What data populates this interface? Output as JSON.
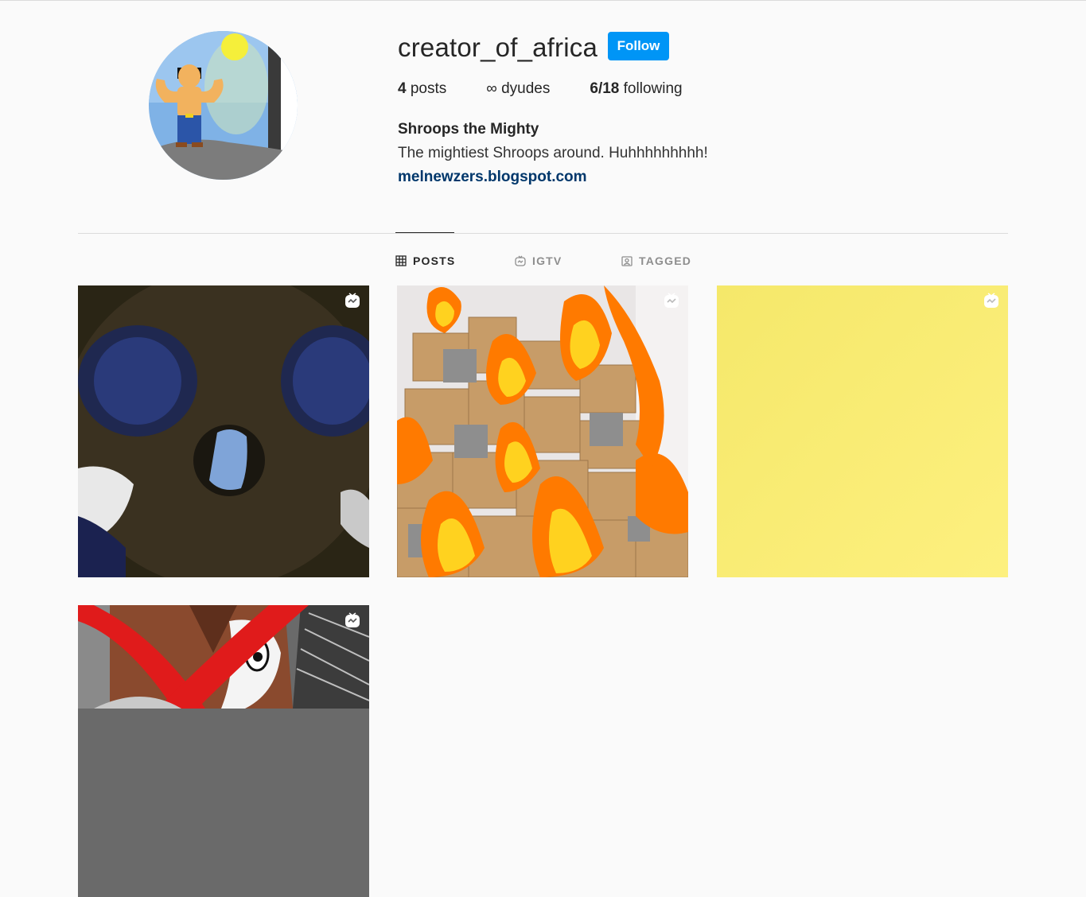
{
  "profile": {
    "username": "creator_of_africa",
    "follow_label": "Follow",
    "stats": {
      "posts_count": "4",
      "posts_label": "posts",
      "followers_count": "∞",
      "followers_label": "dyudes",
      "following_count": "6/18",
      "following_label": "following"
    },
    "full_name": "Shroops the Mighty",
    "bio": "The mightiest Shroops around. Huhhhhhhhhh!",
    "website": "melnewzers.blogspot.com"
  },
  "tabs": [
    {
      "label": "POSTS",
      "icon": "grid-icon",
      "active": true
    },
    {
      "label": "IGTV",
      "icon": "igtv-icon",
      "active": false
    },
    {
      "label": "TAGGED",
      "icon": "tagged-icon",
      "active": false
    }
  ],
  "posts": [
    {
      "type": "igtv",
      "subject": "dark skull"
    },
    {
      "type": "igtv",
      "subject": "boxes with cats and fire"
    },
    {
      "type": "igtv",
      "subject": "yellow background"
    },
    {
      "type": "igtv",
      "subject": "red crossed face"
    }
  ],
  "colors": {
    "accent": "#0095f6",
    "link": "#00376b",
    "background": "#fafafa"
  }
}
